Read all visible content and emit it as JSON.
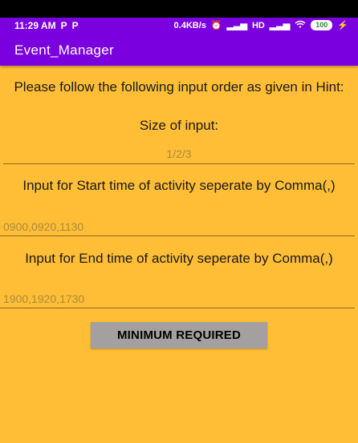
{
  "status_bar": {
    "time": "11:29 AM",
    "left_icons": [
      "P",
      "P"
    ],
    "network_speed": "0.4KB/s",
    "alarm": "⏰",
    "signal1": "▂▃▅",
    "hd": "HD",
    "signal2": "▂▃▅",
    "wifi": "wifi",
    "battery_level": "100",
    "charging": "⚡"
  },
  "app_bar": {
    "title": "Event_Manager"
  },
  "main": {
    "instruction": "Please follow the following input order as given in Hint:",
    "size_label": "Size of input:",
    "size_hint": "1/2/3",
    "start_label": "Input for Start time of activity seperate by Comma(,)",
    "start_hint": "0900,0920,1130",
    "end_label": "Input for End time of activity seperate by Comma(,)",
    "end_hint": "1900,1920,1730",
    "button_label": "MINIMUM REQUIRED"
  },
  "colors": {
    "background": "#FFBE35",
    "app_bar": "#7B00E0",
    "button": "#A4A0A0",
    "hint_text": "#A88A3F"
  }
}
